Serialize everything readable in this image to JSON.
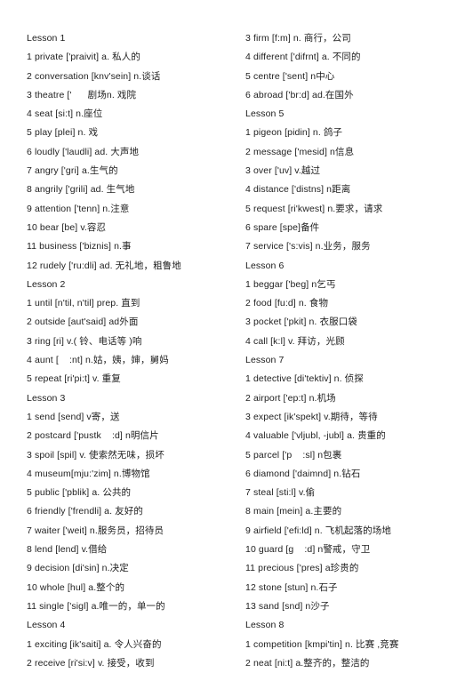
{
  "document": {
    "type": "vocabulary-word-list",
    "language_pair": "English-Chinese",
    "columns": 2
  },
  "left_column": [
    {
      "text": "Lesson 1",
      "kind": "lesson"
    },
    {
      "text": "1 private ['praivit] a. 私人的",
      "kind": "word"
    },
    {
      "text": "2 conversation [knv'sein] n.谈话",
      "kind": "word"
    },
    {
      "text": "3 theatre ['      剧场n. 戏院",
      "kind": "word"
    },
    {
      "text": "4 seat [si:t] n.座位",
      "kind": "word"
    },
    {
      "text": "5 play [plei] n. 戏",
      "kind": "word"
    },
    {
      "text": "6 loudly ['laudli] ad. 大声地",
      "kind": "word"
    },
    {
      "text": "7 angry ['gri] a.生气的",
      "kind": "word"
    },
    {
      "text": "8 angrily ['grili] ad. 生气地",
      "kind": "word"
    },
    {
      "text": "9 attention ['tenn] n.注意",
      "kind": "word"
    },
    {
      "text": "10 bear [be] v.容忍",
      "kind": "word"
    },
    {
      "text": "11 business ['biznis] n.事",
      "kind": "word"
    },
    {
      "text": "12 rudely ['ru:dli] ad. 无礼地，粗鲁地",
      "kind": "word"
    },
    {
      "text": "Lesson 2",
      "kind": "lesson"
    },
    {
      "text": "1 until [n'til, n'til] prep. 直到",
      "kind": "word"
    },
    {
      "text": "2 outside [aut'said] ad外面",
      "kind": "word"
    },
    {
      "text": "3 ring [ri] v.( 铃、电话等 )响",
      "kind": "word"
    },
    {
      "text": "4 aunt [    :nt] n.姑，姨，婶，舅妈",
      "kind": "word"
    },
    {
      "text": "5 repeat [ri'pi:t] v. 重复",
      "kind": "word"
    },
    {
      "text": "Lesson 3",
      "kind": "lesson"
    },
    {
      "text": "1 send [send] v寄，送",
      "kind": "word"
    },
    {
      "text": "2 postcard ['pustk    :d] n明信片",
      "kind": "word"
    },
    {
      "text": "3 spoil [spil] v. 使索然无味，损坏",
      "kind": "word"
    },
    {
      "text": "4 museum[mju:'zim] n.博物馆",
      "kind": "word"
    },
    {
      "text": "5 public ['pblik] a. 公共的",
      "kind": "word"
    },
    {
      "text": "6 friendly ['frendli] a. 友好的",
      "kind": "word"
    },
    {
      "text": "7 waiter ['weit] n.服务员，招待员",
      "kind": "word"
    },
    {
      "text": "8 lend [lend] v.借给",
      "kind": "word"
    },
    {
      "text": "9 decision [di'sin] n.决定",
      "kind": "word"
    },
    {
      "text": "10 whole [hul] a.整个的",
      "kind": "word"
    },
    {
      "text": "11 single ['sigl] a.唯一的，单一的",
      "kind": "word"
    },
    {
      "text": "Lesson 4",
      "kind": "lesson"
    },
    {
      "text": "1 exciting [ik'saiti] a. 令人兴奋的",
      "kind": "word"
    },
    {
      "text": "2 receive [ri'si:v] v. 接受，收到",
      "kind": "word"
    }
  ],
  "right_column": [
    {
      "text": "3 firm [f:m] n. 商行，公司",
      "kind": "word"
    },
    {
      "text": "4 different ['difrnt] a. 不同的",
      "kind": "word"
    },
    {
      "text": "5 centre ['sent] n中心",
      "kind": "word"
    },
    {
      "text": "6 abroad ['br:d] ad.在国外",
      "kind": "word"
    },
    {
      "text": "Lesson 5",
      "kind": "lesson"
    },
    {
      "text": "1 pigeon [pidin] n. 鸽子",
      "kind": "word"
    },
    {
      "text": "2 message ['mesid] n信息",
      "kind": "word"
    },
    {
      "text": "3 over ['uv] v.越过",
      "kind": "word"
    },
    {
      "text": "4 distance ['distns] n距离",
      "kind": "word"
    },
    {
      "text": "5 request [ri'kwest] n.要求，请求",
      "kind": "word"
    },
    {
      "text": "6 spare [spe]备件",
      "kind": "word"
    },
    {
      "text": "7 service ['s:vis] n.业务，服务",
      "kind": "word"
    },
    {
      "text": "Lesson 6",
      "kind": "lesson"
    },
    {
      "text": "1 beggar ['beg] n乞丐",
      "kind": "word"
    },
    {
      "text": "2 food [fu:d] n. 食物",
      "kind": "word"
    },
    {
      "text": "3 pocket ['pkit] n. 衣服口袋",
      "kind": "word"
    },
    {
      "text": "4 call [k:l] v. 拜访，光顾",
      "kind": "word"
    },
    {
      "text": "Lesson 7",
      "kind": "lesson"
    },
    {
      "text": "1 detective [di'tektiv] n. 侦探",
      "kind": "word"
    },
    {
      "text": "2 airport ['ep:t] n.机场",
      "kind": "word"
    },
    {
      "text": "3 expect [ik'spekt] v.期待，等待",
      "kind": "word"
    },
    {
      "text": "4 valuable ['vljubl, -jubl] a. 贵重的",
      "kind": "word"
    },
    {
      "text": "5 parcel ['p    :sl] n包裹",
      "kind": "word"
    },
    {
      "text": "6 diamond ['daimnd] n.钻石",
      "kind": "word"
    },
    {
      "text": "7 steal [sti:l] v.偷",
      "kind": "word"
    },
    {
      "text": "8 main [mein] a.主要的",
      "kind": "word"
    },
    {
      "text": "9 airfield ['efi:ld] n. 飞机起落的场地",
      "kind": "word"
    },
    {
      "text": "10 guard [g    :d] n警戒，守卫",
      "kind": "word"
    },
    {
      "text": "11 precious ['pres] a珍贵的",
      "kind": "word"
    },
    {
      "text": "12 stone [stun] n.石子",
      "kind": "word"
    },
    {
      "text": "13 sand [snd] n沙子",
      "kind": "word"
    },
    {
      "text": "Lesson 8",
      "kind": "lesson"
    },
    {
      "text": "1 competition [kmpi'tin] n. 比赛 ,竞赛",
      "kind": "word"
    },
    {
      "text": "2 neat [ni:t] a.整齐的，整洁的",
      "kind": "word"
    }
  ]
}
